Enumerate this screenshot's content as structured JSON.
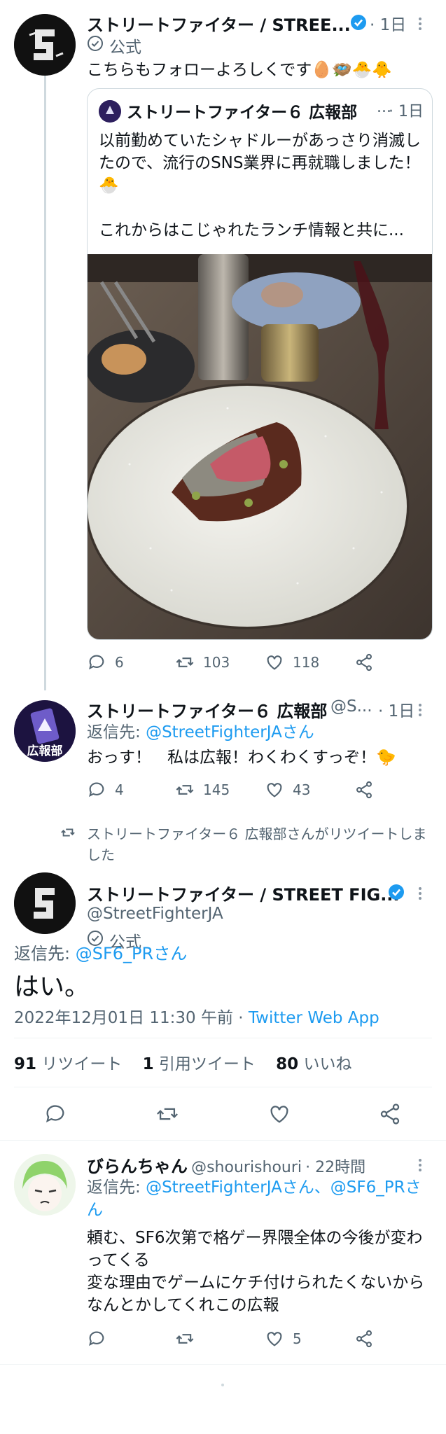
{
  "tweet1": {
    "name": "ストリートファイター / STREE...",
    "time": "· 1日",
    "official": "公式",
    "text": "こちらもフォローよろしくです🥚🪺🐣🐥",
    "quote": {
      "name": "ストリートファイター６ 広報部",
      "handle_ellipsis": "...",
      "time": "· 1日",
      "text": "以前勤めていたシャドルーがあっさり消滅したので、流行のSNS業界に再就職しました！🐣\n\nこれからはこじゃれたランチ情報と共に..."
    },
    "replies": "6",
    "retweets": "103",
    "likes": "118"
  },
  "tweet2": {
    "name": "ストリートファイター６ 広報部",
    "handle": "@S...",
    "time": "· 1日",
    "reply_prefix": "返信先:",
    "reply_to": "@StreetFighterJAさん",
    "text": "おっす！　私は広報！わくわくすっぞ！🐤",
    "avatar_label": "広報部",
    "replies": "4",
    "retweets": "145",
    "likes": "43"
  },
  "retweet_notice": "ストリートファイター６ 広報部さんがリツイートしました",
  "main_tweet": {
    "name": "ストリートファイター / STREET FIG...",
    "handle": "@StreetFighterJA",
    "official": "公式",
    "reply_prefix": "返信先:",
    "reply_to": "@SF6_PRさん",
    "text": "はい。",
    "date": "2022年12月01日 11:30 午前",
    "sep": "·",
    "app": "Twitter Web App",
    "stats": {
      "retweets_num": "91",
      "retweets_label": "リツイート",
      "quotes_num": "1",
      "quotes_label": "引用ツイート",
      "likes_num": "80",
      "likes_label": "いいね"
    }
  },
  "reply_tweet": {
    "name": "びらんちゃん",
    "handle": "@shourishouri",
    "time": "· 22時間",
    "reply_prefix": "返信先:",
    "reply_to": "@StreetFighterJAさん、@SF6_PRさん",
    "text": "頼む、SF6次第で格ゲー界隈全体の今後が変わってくる\n変な理由でゲームにケチ付けられたくないからなんとかしてくれこの広報",
    "likes": "5"
  },
  "colors": {
    "accent": "#1d9bf0",
    "grey": "#536471",
    "thread": "#cfd9de"
  }
}
